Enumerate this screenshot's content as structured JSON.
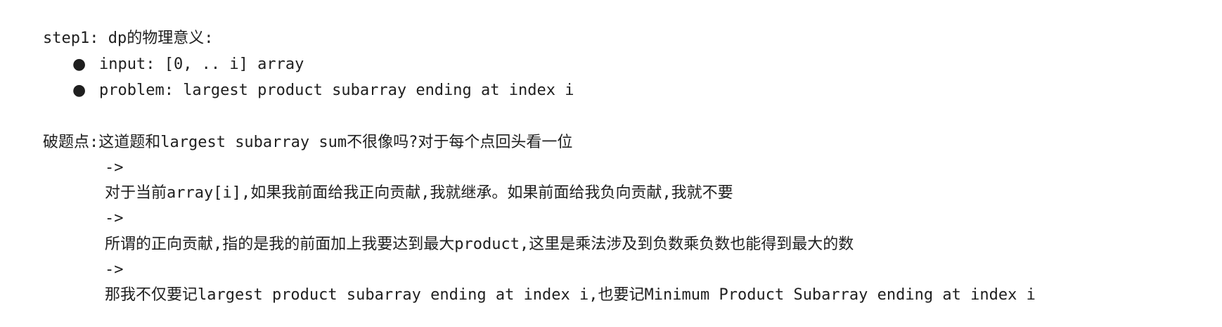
{
  "step": {
    "text": "step1: dp的物理意义:"
  },
  "bullets": [
    {
      "marker": "●",
      "text": "input: [0, .. i] array"
    },
    {
      "marker": "●",
      "text": "problem: largest product subarray ending at index i"
    }
  ],
  "breakthrough": {
    "heading": "破题点:这道题和largest subarray sum不很像吗?对于每个点回头看一位",
    "arrow1": "->",
    "line1": "对于当前array[i],如果我前面给我正向贡献,我就继承。如果前面给我负向贡献,我就不要",
    "arrow2": "->",
    "line2": "所谓的正向贡献,指的是我的前面加上我要达到最大product,这里是乘法涉及到负数乘负数也能得到最大的数",
    "arrow3": "->",
    "line3": "那我不仅要记largest product subarray ending at index i,也要记Minimum Product Subarray ending at index i"
  }
}
